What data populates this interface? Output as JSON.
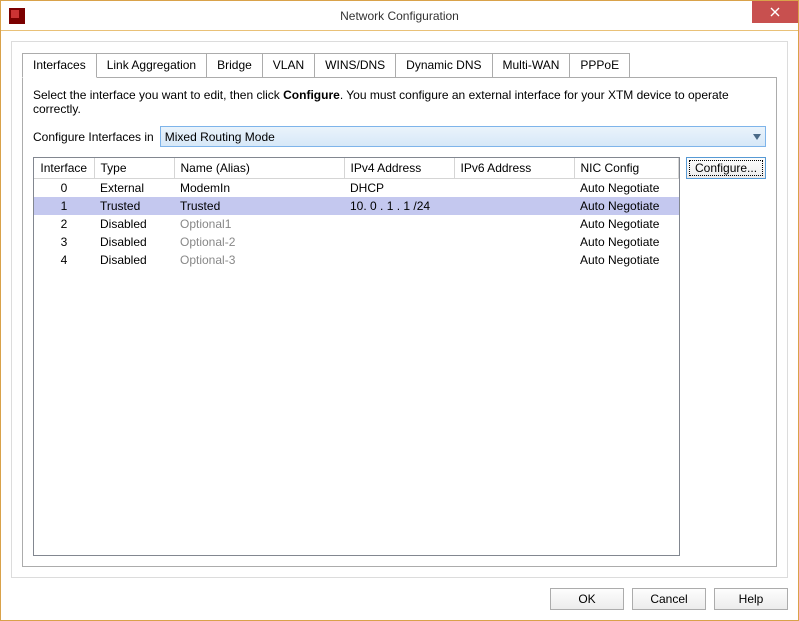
{
  "window": {
    "title": "Network Configuration"
  },
  "tabs": [
    {
      "label": "Interfaces",
      "active": true
    },
    {
      "label": "Link Aggregation"
    },
    {
      "label": "Bridge"
    },
    {
      "label": "VLAN"
    },
    {
      "label": "WINS/DNS"
    },
    {
      "label": "Dynamic DNS"
    },
    {
      "label": "Multi-WAN"
    },
    {
      "label": "PPPoE"
    }
  ],
  "panel": {
    "instruction_pre": "Select the interface you want to edit, then click ",
    "instruction_bold": "Configure",
    "instruction_post": ". You must configure an external interface for your XTM device to operate correctly.",
    "config_label": "Configure Interfaces in",
    "config_value": "Mixed Routing Mode",
    "columns": [
      "Interface",
      "Type",
      "Name (Alias)",
      "IPv4 Address",
      "IPv6 Address",
      "NIC Config"
    ],
    "rows": [
      {
        "iface": "0",
        "type": "External",
        "name": "ModemIn",
        "ipv4": "DHCP",
        "ipv6": "",
        "nic": "Auto Negotiate",
        "disabled": false,
        "selected": false
      },
      {
        "iface": "1",
        "type": "Trusted",
        "name": "Trusted",
        "ipv4": "10. 0 . 1 . 1 /24",
        "ipv6": "",
        "nic": "Auto Negotiate",
        "disabled": false,
        "selected": true
      },
      {
        "iface": "2",
        "type": "Disabled",
        "name": "Optional1",
        "ipv4": "",
        "ipv6": "",
        "nic": "Auto Negotiate",
        "disabled": true,
        "selected": false
      },
      {
        "iface": "3",
        "type": "Disabled",
        "name": "Optional-2",
        "ipv4": "",
        "ipv6": "",
        "nic": "Auto Negotiate",
        "disabled": true,
        "selected": false
      },
      {
        "iface": "4",
        "type": "Disabled",
        "name": "Optional-3",
        "ipv4": "",
        "ipv6": "",
        "nic": "Auto Negotiate",
        "disabled": true,
        "selected": false
      }
    ],
    "configure_button": "Configure..."
  },
  "footer": {
    "ok": "OK",
    "cancel": "Cancel",
    "help": "Help"
  }
}
